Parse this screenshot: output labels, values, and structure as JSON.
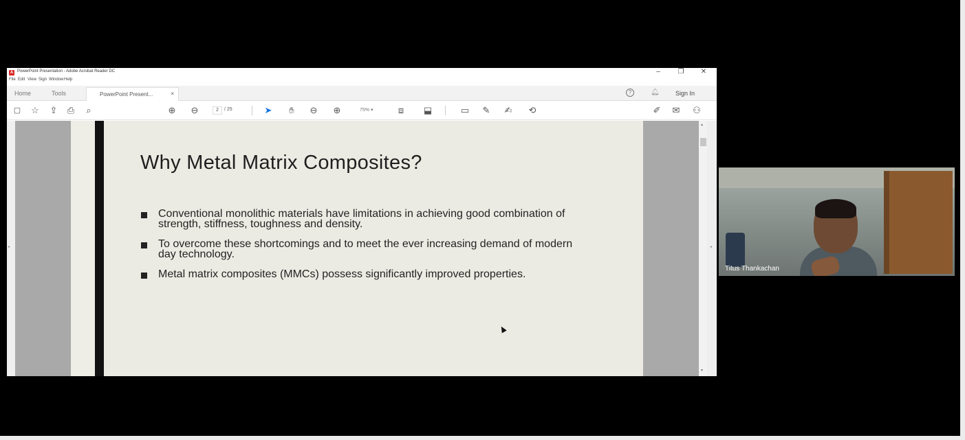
{
  "window": {
    "title": "PowerPoint Presentation - Adobe Acrobat Reader DC",
    "app_icon": "acrobat-icon",
    "controls": {
      "minimize": "–",
      "maximize": "❐",
      "close": "✕"
    }
  },
  "menu": [
    "File",
    "Edit",
    "View",
    "Sign",
    "Window",
    "Help"
  ],
  "tabs": {
    "home": "Home",
    "tools": "Tools",
    "document": "PowerPoint Present...",
    "document_close": "×",
    "help_icon": "?",
    "sign_in": "Sign In"
  },
  "toolbar": {
    "page_current": "2",
    "page_total": "/ 25",
    "zoom": "75%  ▾",
    "icons": [
      "save-icon",
      "bookmark-star-icon",
      "upload-cloud-icon",
      "print-icon",
      "zoom-search-icon",
      "page-up-icon",
      "page-down-icon",
      "select-cursor-icon",
      "hand-icon",
      "zoom-out-icon",
      "zoom-in-icon",
      "fit-page-icon",
      "scroll-mode-icon",
      "comment-icon",
      "highlight-pen-icon",
      "sign-icon",
      "share-stamp-icon",
      "fill-sign-icon",
      "mail-icon",
      "add-user-icon"
    ]
  },
  "slide": {
    "title": "Why Metal Matrix Composites?",
    "bullets": [
      "Conventional monolithic materials have limitations in achieving good combination of strength, stiffness, toughness and density.",
      "To overcome these shortcomings and to meet the ever increasing demand of modern day technology.",
      "Metal matrix composites (MMCs) possess significantly improved properties."
    ]
  },
  "participant": {
    "name": "Titus Thankachan"
  },
  "colors": {
    "slide_background": "#ecebe3",
    "slide_accent_bar": "#121212",
    "acrobat_red": "#d92b2b",
    "selected_tool_blue": "#1473e6"
  }
}
